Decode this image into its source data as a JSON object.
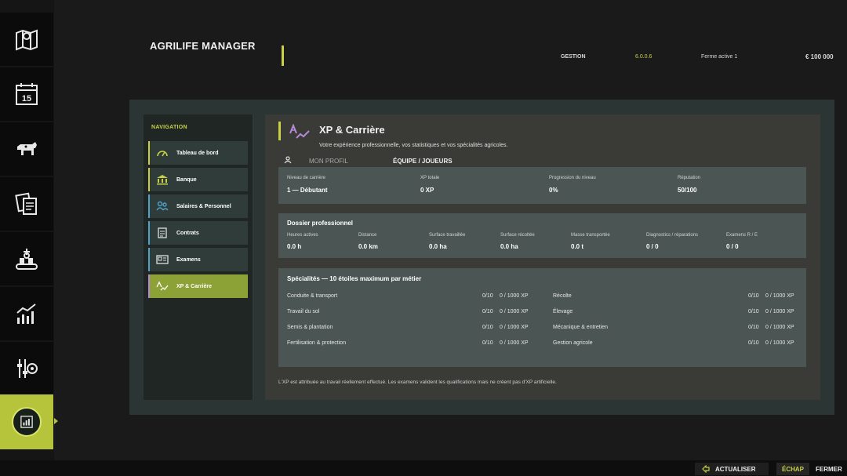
{
  "header": {
    "app_title": "AGRILIFE MANAGER",
    "section": "GESTION",
    "version": "6.0.0.6",
    "farm": "Ferme active 1",
    "money": "€ 100 000"
  },
  "rail": {
    "items": [
      {
        "icon": "map-icon"
      },
      {
        "icon": "calendar-icon",
        "text": "15"
      },
      {
        "icon": "animals-icon"
      },
      {
        "icon": "contracts-icon"
      },
      {
        "icon": "production-icon"
      },
      {
        "icon": "statistics-icon"
      },
      {
        "icon": "settings-icon"
      },
      {
        "icon": "agrilife-icon",
        "active": true
      }
    ]
  },
  "navigation": {
    "title": "NAVIGATION",
    "items": [
      {
        "label": "Tableau de bord",
        "icon": "dashboard-icon"
      },
      {
        "label": "Banque",
        "icon": "bank-icon"
      },
      {
        "label": "Salaires & Personnel",
        "icon": "staff-icon"
      },
      {
        "label": "Contrats",
        "icon": "contract-icon"
      },
      {
        "label": "Examens",
        "icon": "exam-icon"
      },
      {
        "label": "XP & Carrière",
        "icon": "xp-icon",
        "active": true
      }
    ]
  },
  "content": {
    "title": "XP & Carrière",
    "subtitle": "Votre expérience professionnelle, vos statistiques et vos spécialités agricoles.",
    "tabs": [
      {
        "label": "MON PROFIL",
        "active": false
      },
      {
        "label": "ÉQUIPE / JOUEURS",
        "active": true
      }
    ],
    "level": {
      "career_label": "Niveau de carrière",
      "career_value": "1 — Débutant",
      "xp_label": "XP totale",
      "xp_value": "0 XP",
      "progress_label": "Progression du niveau",
      "progress_value": "0%",
      "reputation_label": "Réputation",
      "reputation_value": "50/100"
    },
    "dossier": {
      "title": "Dossier professionnel",
      "stats": [
        {
          "label": "Heures actives",
          "value": "0.0 h"
        },
        {
          "label": "Distance",
          "value": "0.0 km"
        },
        {
          "label": "Surface travaillée",
          "value": "0.0 ha"
        },
        {
          "label": "Surface récoltée",
          "value": "0.0 ha"
        },
        {
          "label": "Masse transportée",
          "value": "0.0 t"
        },
        {
          "label": "Diagnostics / réparations",
          "value": "0 / 0"
        },
        {
          "label": "Examens R / E",
          "value": "0 / 0"
        }
      ]
    },
    "specialties": {
      "title": "Spécialités — 10 étoiles maximum par métier",
      "left": [
        {
          "name": "Conduite & transport",
          "stars": "0/10",
          "xp": "0 / 1000 XP"
        },
        {
          "name": "Travail du sol",
          "stars": "0/10",
          "xp": "0 / 1000 XP"
        },
        {
          "name": "Semis & plantation",
          "stars": "0/10",
          "xp": "0 / 1000 XP"
        },
        {
          "name": "Fertilisation & protection",
          "stars": "0/10",
          "xp": "0 / 1000 XP"
        }
      ],
      "right": [
        {
          "name": "Récolte",
          "stars": "0/10",
          "xp": "0 / 1000 XP"
        },
        {
          "name": "Élevage",
          "stars": "0/10",
          "xp": "0 / 1000 XP"
        },
        {
          "name": "Mécanique & entretien",
          "stars": "0/10",
          "xp": "0 / 1000 XP"
        },
        {
          "name": "Gestion agricole",
          "stars": "0/10",
          "xp": "0 / 1000 XP"
        }
      ]
    },
    "footnote": "L'XP est attribuée au travail réellement effectué. Les examens valident les qualifications mais ne créent pas d'XP artificielle."
  },
  "footer": {
    "refresh_label": "ACTUALISER",
    "escape_key": "ÉCHAP",
    "close_label": "FERMER"
  },
  "colors": {
    "accent": "#c8d143",
    "active_nav": "#8da236",
    "card": "#4b5554"
  }
}
